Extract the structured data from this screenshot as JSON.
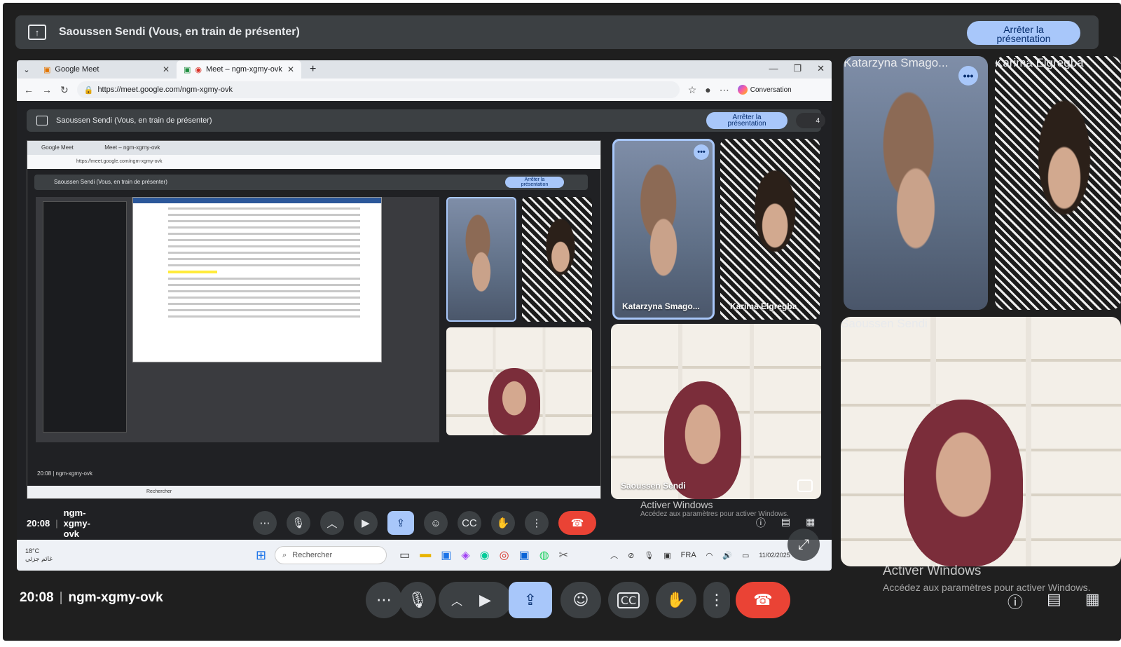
{
  "present_bar": {
    "title": "Saoussen Sendi (Vous, en train de présenter)",
    "stop_label_1": "Arrêter la",
    "stop_label_2": "présentation"
  },
  "browser": {
    "tab1": "Google Meet",
    "tab2": "Meet – ngm-xgmy-ovk",
    "url": "https://meet.google.com/ngm-xgmy-ovk",
    "conversation": "Conversation"
  },
  "inner": {
    "present_title": "Saoussen Sendi (Vous, en train de présenter)",
    "stop_1": "Arrêter la",
    "stop_2": "présentation",
    "count": "4",
    "time": "20:08",
    "code": "ngm-xgmy-ovk",
    "rec_tab1": "Google Meet",
    "rec_tab2": "Meet – ngm-xgmy-ovk",
    "rec_url": "https://meet.google.com/ngm-xgmy-ovk",
    "rec_title": "Saoussen Sendi (Vous, en train de présenter)",
    "rec_time": "20:08  |  ngm-xgmy-ovk",
    "rec_search": "Rechercher"
  },
  "participants": {
    "katarzyna": "Katarzyna Smago...",
    "karima": "Karima Elgregba",
    "saoussen": "Saoussen Sendi"
  },
  "activate_windows": {
    "title": "Activer Windows",
    "subtitle": "Accédez aux paramètres pour activer Windows."
  },
  "taskbar": {
    "weather": "18°C",
    "weather_sub": "غائم جزئي",
    "search": "Rechercher",
    "lang": "FRA",
    "date": "11/02/2025"
  },
  "controls": {
    "time": "20:08",
    "meeting_code": "ngm-xgmy-ovk"
  }
}
